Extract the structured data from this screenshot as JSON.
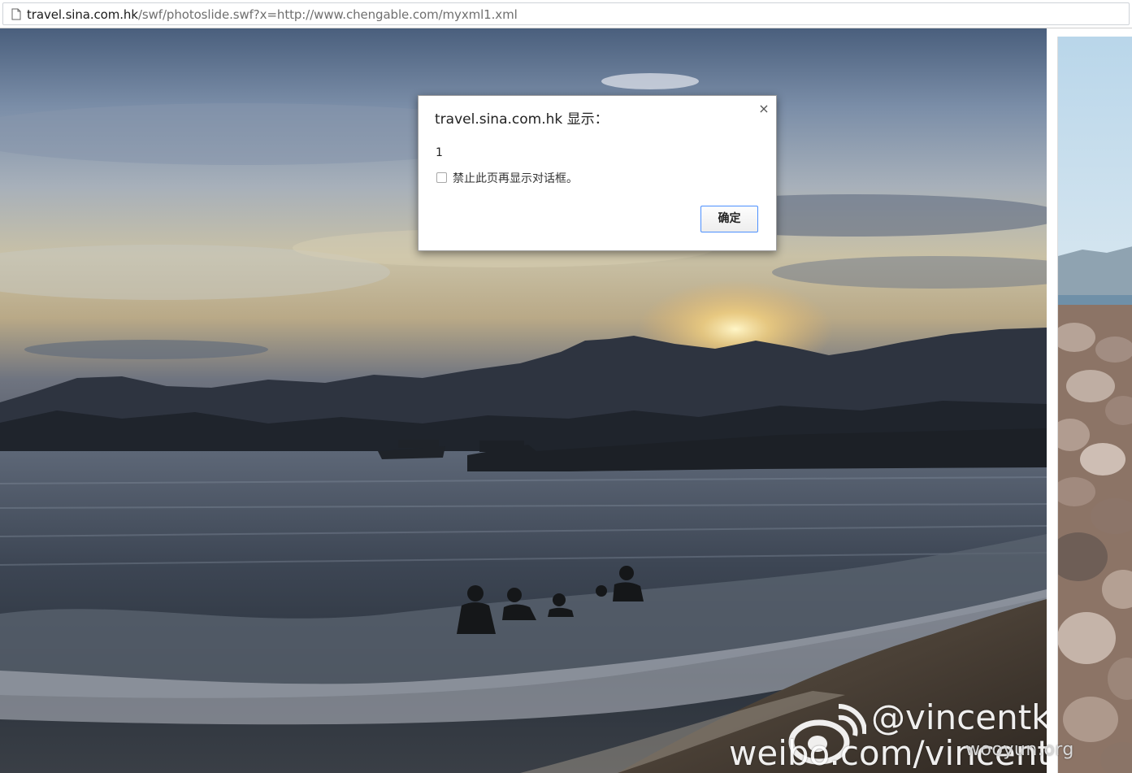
{
  "browser": {
    "url_host": "travel.sina.com.hk",
    "url_path": "/swf/photoslide.swf?x=http://www.chengable.com/myxml1.xml",
    "page_icon": "document-icon"
  },
  "photo": {
    "watermark_handle": "@vincentkit",
    "watermark_url": "weibo.com/vincentkit",
    "watermark_logo": "weibo-logo-icon"
  },
  "site_watermark": "wooyun.org",
  "alert": {
    "title": "travel.sina.com.hk 显示：",
    "message": "1",
    "checkbox_label": "禁止此页再显示对话框。",
    "checkbox_checked": false,
    "ok_label": "确定",
    "close_icon": "close-icon"
  }
}
